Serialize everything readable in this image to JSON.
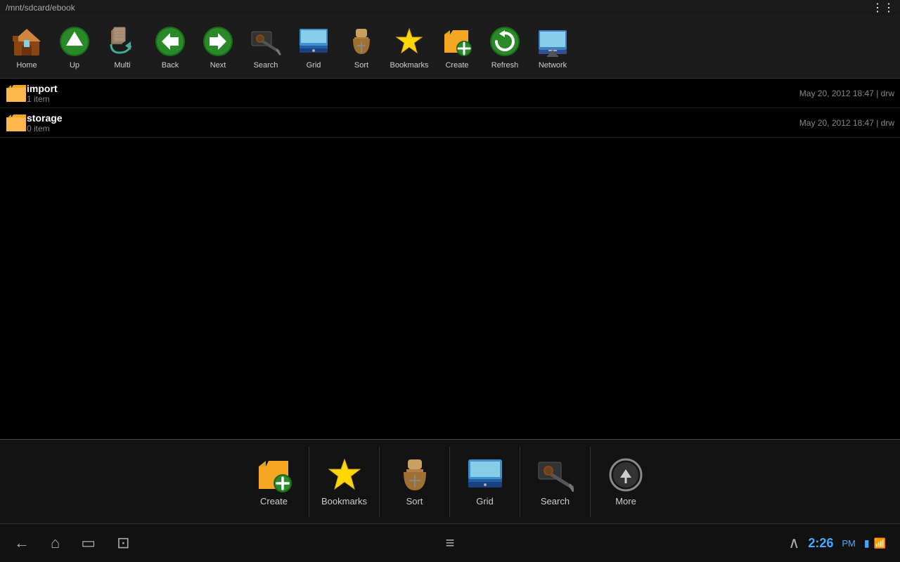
{
  "titlebar": {
    "path": "/mnt/sdcard/ebook",
    "menu_icon": "≡"
  },
  "toolbar": {
    "buttons": [
      {
        "id": "home",
        "label": "Home",
        "icon": "🏠"
      },
      {
        "id": "up",
        "label": "Up",
        "icon": "⬆"
      },
      {
        "id": "multi",
        "label": "Multi",
        "icon": "📦"
      },
      {
        "id": "back",
        "label": "Back",
        "icon": "◀"
      },
      {
        "id": "next",
        "label": "Next",
        "icon": "▶"
      },
      {
        "id": "search",
        "label": "Search",
        "icon": "🔭"
      },
      {
        "id": "grid",
        "label": "Grid",
        "icon": "🖥"
      },
      {
        "id": "sort",
        "label": "Sort",
        "icon": "⏳"
      },
      {
        "id": "bookmarks",
        "label": "Bookmarks",
        "icon": "⭐"
      },
      {
        "id": "create",
        "label": "Create",
        "icon": "📁+"
      },
      {
        "id": "refresh",
        "label": "Refresh",
        "icon": "🔄"
      },
      {
        "id": "network",
        "label": "Network",
        "icon": "🖥"
      }
    ]
  },
  "files": [
    {
      "name": "import",
      "count": "1 item",
      "meta": "May 20, 2012 18:47 | drw"
    },
    {
      "name": "storage",
      "count": "0 item",
      "meta": "May 20, 2012 18:47 | drw"
    }
  ],
  "bottom_bar": {
    "buttons": [
      {
        "id": "create",
        "label": "Create",
        "icon": "📁"
      },
      {
        "id": "bookmarks",
        "label": "Bookmarks",
        "icon": "⭐"
      },
      {
        "id": "sort",
        "label": "Sort",
        "icon": "⏳"
      },
      {
        "id": "grid",
        "label": "Grid",
        "icon": "🖥"
      },
      {
        "id": "search",
        "label": "Search",
        "icon": "🔭"
      },
      {
        "id": "more",
        "label": "More",
        "icon": "⊕"
      }
    ]
  },
  "navbar": {
    "time": "2:26",
    "ampm": "PM",
    "back_icon": "←",
    "home_icon": "⌂",
    "recents_icon": "▭",
    "screenshot_icon": "⊡",
    "menu_icon": "≡",
    "up_icon": "∧"
  }
}
